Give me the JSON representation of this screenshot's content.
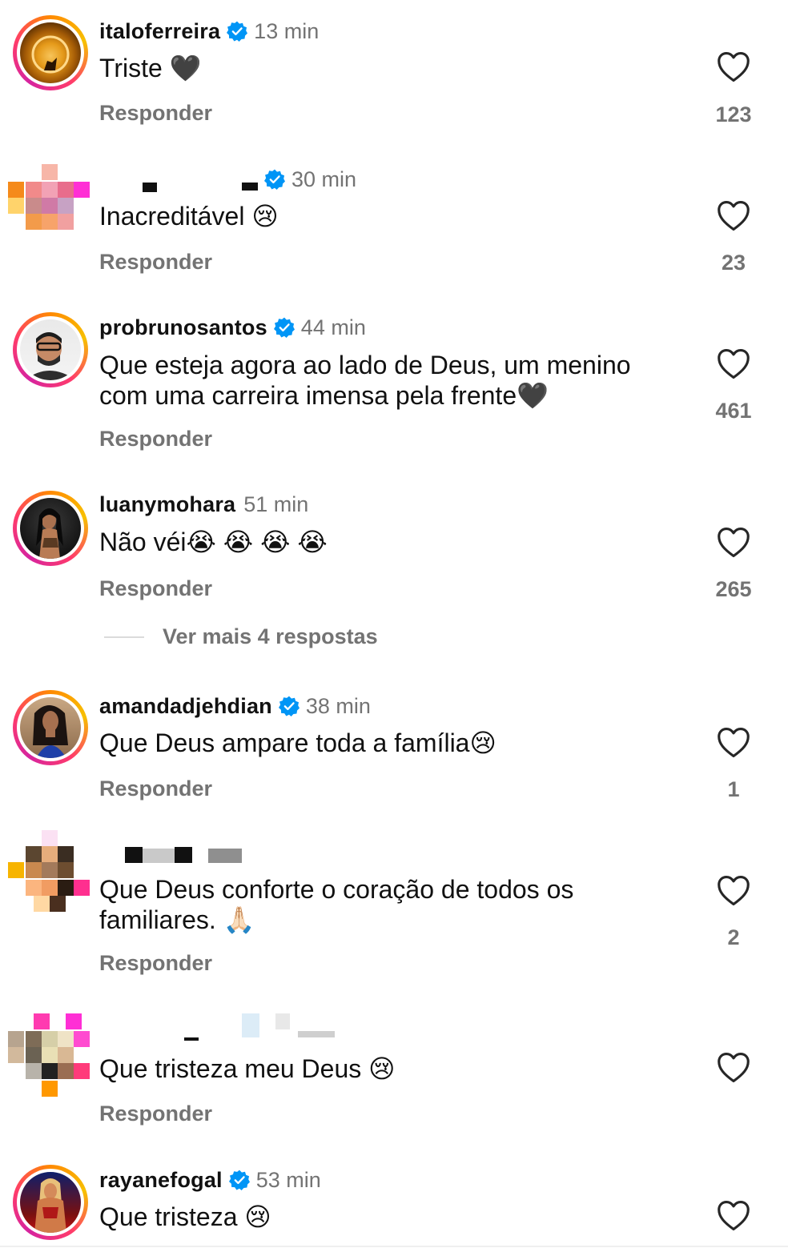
{
  "comments": [
    {
      "username": "italoferreira",
      "time": "13 min",
      "text": "Triste 🖤",
      "reply": "Responder",
      "likes": "123"
    },
    {
      "username": "",
      "time": "30 min",
      "text": "Inacreditável 😢",
      "reply": "Responder",
      "likes": "23"
    },
    {
      "username": "probrunosantos",
      "time": "44 min",
      "text": "Que esteja agora ao lado de Deus, um menino com uma carreira imensa pela frente🖤",
      "reply": "Responder",
      "likes": "461"
    },
    {
      "username": "luanymohara",
      "time": "51 min",
      "text": "Não véi😭 😭 😭 😭",
      "reply": "Responder",
      "likes": "265"
    },
    {
      "username": "amandadjehdian",
      "time": "38 min",
      "text": "Que Deus ampare toda a família😢",
      "reply": "Responder",
      "likes": "1"
    },
    {
      "username": "",
      "time": "",
      "text": "Que Deus conforte o coração de todos os familiares. 🙏🏻",
      "reply": "Responder",
      "likes": "2"
    },
    {
      "username": "",
      "time": "",
      "text": "Que tristeza meu Deus 😢",
      "reply": "Responder",
      "likes": ""
    },
    {
      "username": "rayanefogal",
      "time": "53 min",
      "text": "Que tristeza 😢",
      "reply": "",
      "likes": ""
    }
  ],
  "view_more_replies": "Ver mais 4 respostas",
  "icons": {
    "like": "heart-outline-icon",
    "verified": "verified-badge-icon"
  },
  "colors": {
    "verified": "#0095f6",
    "secondary_text": "#737373"
  }
}
